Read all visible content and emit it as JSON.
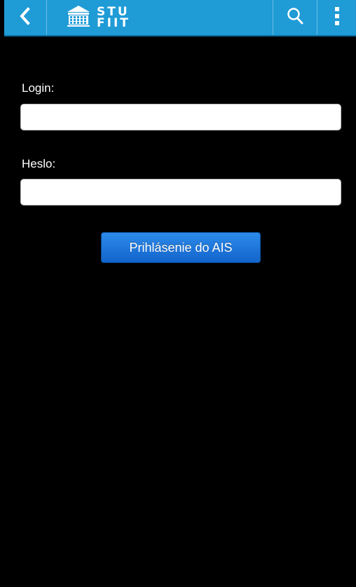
{
  "action_bar": {
    "back_icon": "chevron-left-icon",
    "logo": {
      "icon": "building-icon",
      "line1": "STU",
      "line2": "FIIT"
    },
    "search_icon": "search-icon",
    "menu_icon": "overflow-menu-icon",
    "color": "#1f9bd6"
  },
  "form": {
    "login_label": "Login:",
    "login_value": "",
    "password_label": "Heslo:",
    "password_value": "",
    "submit_label": "Prihlásenie do AIS",
    "submit_color": "#1a73db"
  },
  "background_color": "#000000"
}
